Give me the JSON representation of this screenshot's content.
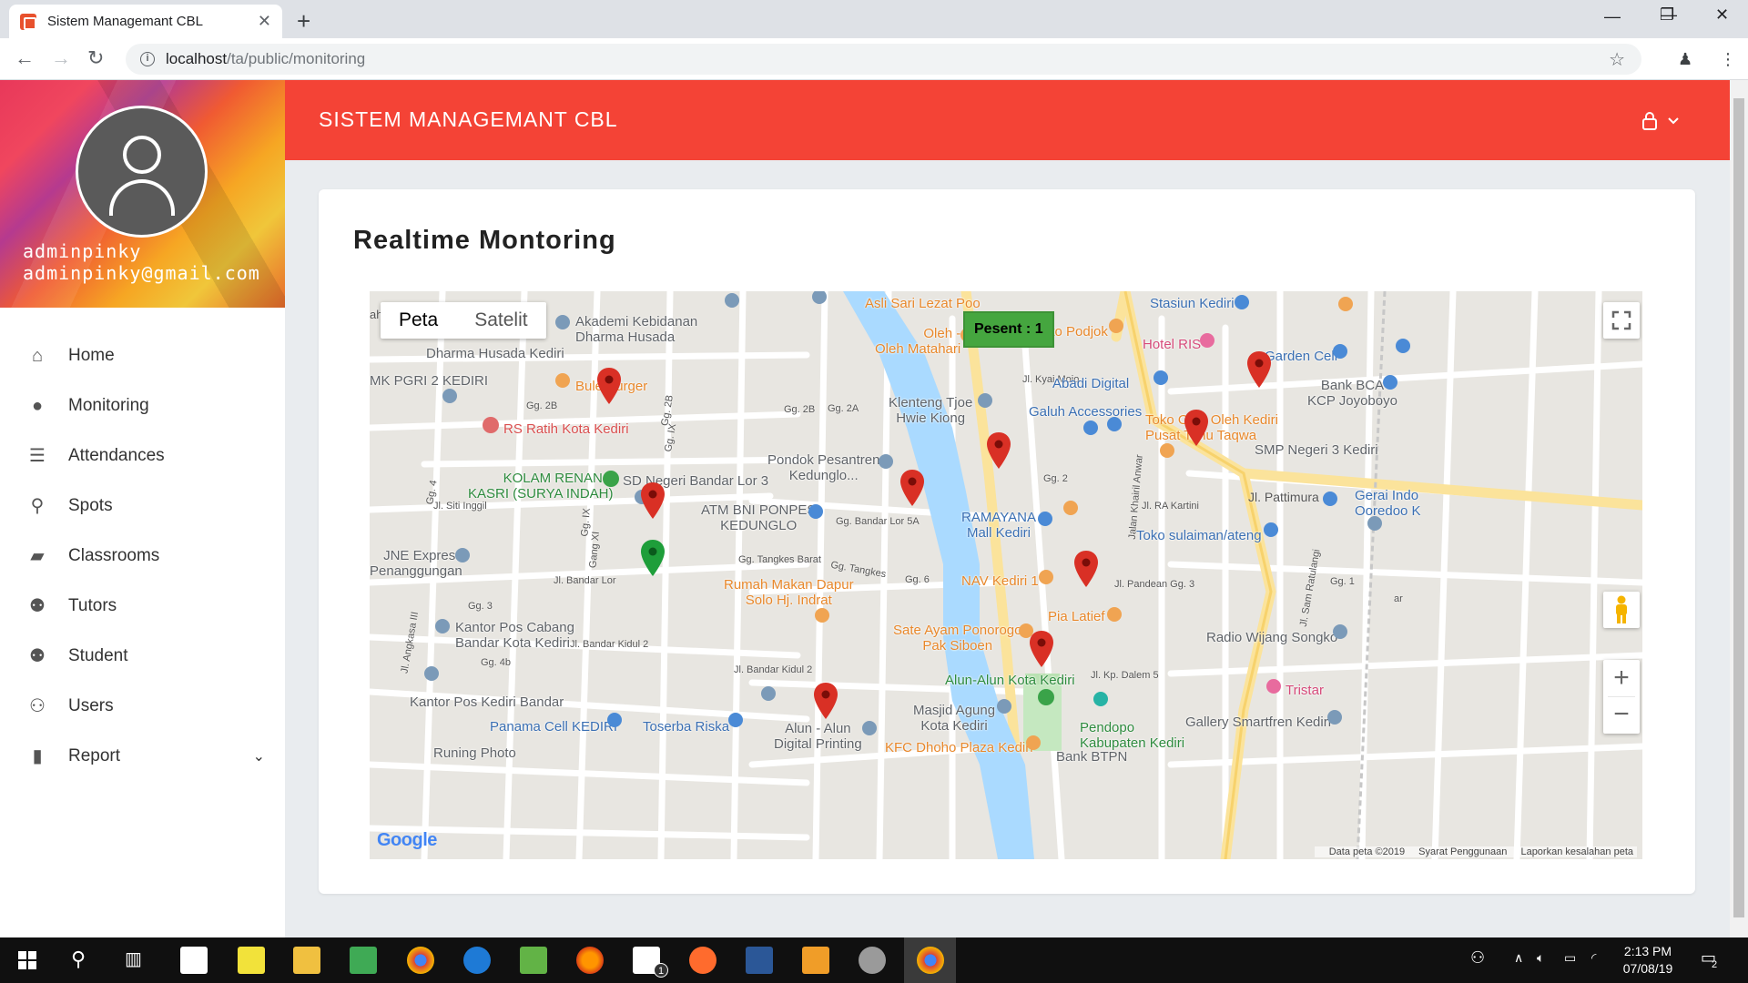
{
  "browser": {
    "tab_title": "Sistem Managemant CBL",
    "tab_close": "✕",
    "new_tab": "+",
    "url_host": "localhost",
    "url_path": "/ta/public/monitoring",
    "win_min": "—",
    "win_max": "❐",
    "win_close": "✕"
  },
  "sidebar": {
    "user_name": "adminpinky",
    "user_email": "adminpinky@gmail.com",
    "items": [
      {
        "label": "Home",
        "icon": "home-icon",
        "glyph": "⌂"
      },
      {
        "label": "Monitoring",
        "icon": "map-pin-icon",
        "glyph": "●"
      },
      {
        "label": "Attendances",
        "icon": "list-icon",
        "glyph": "☰"
      },
      {
        "label": "Spots",
        "icon": "pushpin-icon",
        "glyph": "⚲"
      },
      {
        "label": "Classrooms",
        "icon": "book-icon",
        "glyph": "▰"
      },
      {
        "label": "Tutors",
        "icon": "users-icon",
        "glyph": "⚉"
      },
      {
        "label": "Student",
        "icon": "users-icon",
        "glyph": "⚉"
      },
      {
        "label": "Users",
        "icon": "user-icon",
        "glyph": "⚇"
      },
      {
        "label": "Report",
        "icon": "bookmark-icon",
        "glyph": "▮"
      }
    ],
    "report_chevron": "⌄"
  },
  "header": {
    "title": "SISTEM MANAGEMANT CBL",
    "user_menu": "⚲ ⌄"
  },
  "main": {
    "card_title": "Realtime Montoring"
  },
  "map": {
    "tab_map": "Peta",
    "tab_satellite": "Satelit",
    "info_box": "Pesent : 1",
    "zoom_in": "+",
    "zoom_out": "−",
    "fullscreen": "⛶",
    "google": "Google",
    "footer_data": "Data peta ©2019",
    "footer_terms": "Syarat Penggunaan",
    "footer_report": "Laporkan kesalahan peta",
    "pois": [
      {
        "text": "Akademi Kebidanan\nDharma Husada",
        "kind": "gray"
      },
      {
        "text": "Dharma Husada Kediri",
        "kind": "gray"
      },
      {
        "text": "MK PGRI 2 KEDIRI",
        "kind": "gray"
      },
      {
        "text": "Bule Burger",
        "kind": "food"
      },
      {
        "text": "RS Ratih Kota Kediri",
        "kind": "hosp"
      },
      {
        "text": "KOLAM RENANG\nKASRI (SURYA INDAH)",
        "kind": "green"
      },
      {
        "text": "SD Negeri Bandar Lor 3",
        "kind": "gray"
      },
      {
        "text": "ATM BNI PONPES\nKEDUNGLO",
        "kind": "gray"
      },
      {
        "text": "Pondok Pesantren\nKedunglo...",
        "kind": "gray"
      },
      {
        "text": "JNE Express\nPenanggungan",
        "kind": "gray"
      },
      {
        "text": "Rumah Makan Dapur\nSolo Hj. Indrat",
        "kind": "food"
      },
      {
        "text": "Kantor Pos Cabang\nBandar Kota Kediri",
        "kind": "gray"
      },
      {
        "text": "Kantor Pos Kediri Bandar",
        "kind": "gray"
      },
      {
        "text": "Panama Cell KEDIRI",
        "kind": "shop"
      },
      {
        "text": "Toserba Riska",
        "kind": "shop"
      },
      {
        "text": "Alun - Alun\nDigital Printing",
        "kind": "gray"
      },
      {
        "text": "Asli Sari Lezat Poo",
        "kind": "food"
      },
      {
        "text": "Oleh -\nOleh Matahari",
        "kind": "food"
      },
      {
        "text": "Klenteng Tjoe\nHwie Kiong",
        "kind": "gray"
      },
      {
        "text": "Soto Podjok",
        "kind": "food"
      },
      {
        "text": "Stasiun Kediri",
        "kind": "shop"
      },
      {
        "text": "Hotel RIS",
        "kind": "pink"
      },
      {
        "text": "Garden Cell",
        "kind": "shop"
      },
      {
        "text": "Abadi Digital",
        "kind": "shop"
      },
      {
        "text": "Bank BCA\nKCP Joyoboyo",
        "kind": "gray"
      },
      {
        "text": "Galuh Accessories",
        "kind": "shop"
      },
      {
        "text": "Toko Oleh Oleh Kediri\nPusat Tahu Taqwa",
        "kind": "food"
      },
      {
        "text": "SMP Negeri 3 Kediri",
        "kind": "gray"
      },
      {
        "text": "Gerai Indo\nOoredoo K",
        "kind": "shop"
      },
      {
        "text": "RAMAYANA\nMall Kediri",
        "kind": "shop"
      },
      {
        "text": "Toko sulaiman/ateng",
        "kind": "shop"
      },
      {
        "text": "NAV Kediri 1",
        "kind": "food"
      },
      {
        "text": "Pia Latief",
        "kind": "food"
      },
      {
        "text": "Sate Ayam Ponorogo\nPak Siboen",
        "kind": "food"
      },
      {
        "text": "Radio Wijang Songko",
        "kind": "gray"
      },
      {
        "text": "Alun-Alun Kota Kediri",
        "kind": "green"
      },
      {
        "text": "Tristar",
        "kind": "pink"
      },
      {
        "text": "Masjid Agung\nKota Kediri",
        "kind": "gray"
      },
      {
        "text": "Pendopo\nKabupaten Kediri",
        "kind": "green"
      },
      {
        "text": "Gallery Smartfren Kediri",
        "kind": "gray"
      },
      {
        "text": "KFC Dhoho Plaza Kediri",
        "kind": "food"
      },
      {
        "text": "Runing Photo",
        "kind": "gray"
      },
      {
        "text": "Bank BTPN",
        "kind": "gray"
      }
    ],
    "roads": [
      "Gg. 2B",
      "Gg. 2B",
      "Gg. 2B",
      "Gg. 2A",
      "Gg. IX",
      "Gg. 4",
      "Jl. Siti Inggil",
      "Gg. IX",
      "Gang XI",
      "Gg. Bandar Lor 5A",
      "Gg. Tangkes Barat",
      "Gg. Tangkes",
      "Gg. 6",
      "Jl. Bandar Lor",
      "Gg. 3",
      "Jl. Bandar Kidul 2",
      "Jl. Angkasa III",
      "Gg. 4b",
      "Jl. Bandar Kidul 2",
      "Jl. Kyai Mojo",
      "Gg. 2",
      "Jalan Khairil Anwar",
      "Jl. RA Kartini",
      "Jl. Pattimura",
      "Jl. Pandean Gg. 3",
      "Jl. Kp. Dalem 5",
      "Jl. Sam Ratulangi",
      "Gg. 1",
      "ah",
      "ar"
    ],
    "marker_colors": {
      "red": "#d93025",
      "green": "#1e9e3a"
    }
  },
  "taskbar": {
    "time": "2:13 PM",
    "date": "07/08/19",
    "notif_count": "2",
    "mail_badge": "1"
  }
}
